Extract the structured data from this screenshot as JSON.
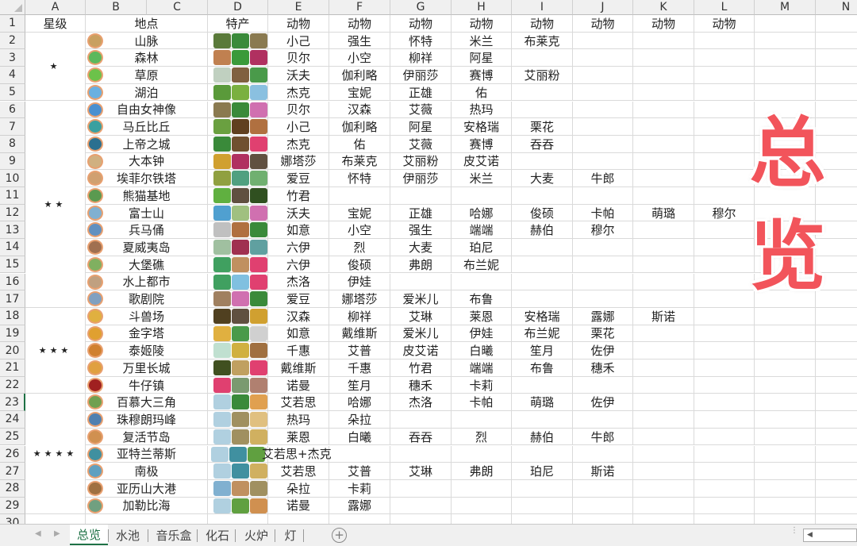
{
  "columns": [
    "A",
    "B",
    "C",
    "D",
    "E",
    "F",
    "G",
    "H",
    "I",
    "J",
    "K",
    "L",
    "M",
    "N"
  ],
  "header_row": {
    "star": "星级",
    "place": "地点",
    "specialty": "特产",
    "animals": [
      "动物",
      "动物",
      "动物",
      "动物",
      "动物",
      "动物",
      "动物",
      "动物"
    ]
  },
  "star_groups": [
    {
      "label": "★",
      "from": 2,
      "to": 5
    },
    {
      "label": "★★",
      "from": 6,
      "to": 17
    },
    {
      "label": "★★★",
      "from": 18,
      "to": 22
    },
    {
      "label": "★★★★",
      "from": 23,
      "to": 29
    }
  ],
  "rows": [
    {
      "place": "山脉",
      "animals": [
        "小己",
        "强生",
        "怀特",
        "米兰",
        "布莱克"
      ]
    },
    {
      "place": "森林",
      "animals": [
        "贝尔",
        "小空",
        "柳祥",
        "阿星"
      ]
    },
    {
      "place": "草原",
      "animals": [
        "沃夫",
        "伽利略",
        "伊丽莎",
        "赛博",
        "艾丽粉"
      ]
    },
    {
      "place": "湖泊",
      "animals": [
        "杰克",
        "宝妮",
        "正雄",
        "佑"
      ]
    },
    {
      "place": "自由女神像",
      "animals": [
        "贝尔",
        "汉森",
        "艾薇",
        "热玛"
      ]
    },
    {
      "place": "马丘比丘",
      "animals": [
        "小己",
        "伽利略",
        "阿星",
        "安格瑞",
        "栗花"
      ]
    },
    {
      "place": "上帝之城",
      "animals": [
        "杰克",
        "佑",
        "艾薇",
        "赛博",
        "吞吞"
      ]
    },
    {
      "place": "大本钟",
      "animals": [
        "娜塔莎",
        "布莱克",
        "艾丽粉",
        "皮艾诺"
      ]
    },
    {
      "place": "埃菲尔铁塔",
      "animals": [
        "爱豆",
        "怀特",
        "伊丽莎",
        "米兰",
        "大麦",
        "牛郎"
      ]
    },
    {
      "place": "熊猫基地",
      "animals": [
        "竹君"
      ]
    },
    {
      "place": "富士山",
      "animals": [
        "沃夫",
        "宝妮",
        "正雄",
        "哈娜",
        "俊硕",
        "卡帕",
        "萌璐",
        "穆尔"
      ]
    },
    {
      "place": "兵马俑",
      "animals": [
        "如意",
        "小空",
        "强生",
        "端端",
        "赫伯",
        "穆尔"
      ]
    },
    {
      "place": "夏威夷岛",
      "animals": [
        "六伊",
        "烈",
        "大麦",
        "珀尼"
      ]
    },
    {
      "place": "大堡礁",
      "animals": [
        "六伊",
        "俊硕",
        "弗朗",
        "布兰妮"
      ]
    },
    {
      "place": "水上都市",
      "animals": [
        "杰洛",
        "伊娃"
      ]
    },
    {
      "place": "歌剧院",
      "animals": [
        "爱豆",
        "娜塔莎",
        "爱米儿",
        "布鲁"
      ]
    },
    {
      "place": "斗兽场",
      "animals": [
        "汉森",
        "柳祥",
        "艾琳",
        "莱恩",
        "安格瑞",
        "露娜",
        "斯诺"
      ]
    },
    {
      "place": "金字塔",
      "animals": [
        "如意",
        "戴维斯",
        "爱米儿",
        "伊娃",
        "布兰妮",
        "栗花"
      ]
    },
    {
      "place": "泰姬陵",
      "animals": [
        "千惠",
        "艾普",
        "皮艾诺",
        "白曦",
        "笙月",
        "佐伊"
      ]
    },
    {
      "place": "万里长城",
      "animals": [
        "戴维斯",
        "千惠",
        "竹君",
        "端端",
        "布鲁",
        "穗禾"
      ]
    },
    {
      "place": "牛仔镇",
      "animals": [
        "诺曼",
        "笙月",
        "穗禾",
        "卡莉"
      ]
    },
    {
      "place": "百慕大三角",
      "animals": [
        "艾若思",
        "哈娜",
        "杰洛",
        "卡帕",
        "萌璐",
        "佐伊"
      ]
    },
    {
      "place": "珠穆朗玛峰",
      "animals": [
        "热玛",
        "朵拉"
      ]
    },
    {
      "place": "复活节岛",
      "animals": [
        "莱恩",
        "白曦",
        "吞吞",
        "烈",
        "赫伯",
        "牛郎"
      ]
    },
    {
      "place": "亚特兰蒂斯",
      "specialty_note": "艾若思+杰克",
      "animals": []
    },
    {
      "place": "南极",
      "animals": [
        "艾若思",
        "艾普",
        "艾琳",
        "弗朗",
        "珀尼",
        "斯诺"
      ]
    },
    {
      "place": "亚历山大港",
      "animals": [
        "朵拉",
        "卡莉"
      ]
    },
    {
      "place": "加勒比海",
      "animals": [
        "诺曼",
        "露娜"
      ]
    }
  ],
  "badge_colors": [
    "#c9a060",
    "#5cb85c",
    "#6cc24a",
    "#6ab0e0",
    "#4a90d0",
    "#3aa0a0",
    "#2a7090",
    "#d0b080",
    "#d0a070",
    "#5a9a50",
    "#80b0d0",
    "#6090c0",
    "#a07050",
    "#80b060",
    "#c0a080",
    "#80a0c0",
    "#e0b040",
    "#e0a030",
    "#d08030",
    "#e0a040",
    "#a02020",
    "#70a050",
    "#5080b0",
    "#d09050",
    "#4090a0",
    "#60a0c0",
    "#a07040",
    "#70a080"
  ],
  "specialty_colors": [
    [
      "#5a7a3a",
      "#3a8a3a",
      "#8a7a50"
    ],
    [
      "#c08050",
      "#3a9a3a",
      "#b03060"
    ],
    [
      "#c0d0c0",
      "#806040",
      "#4a9a4a"
    ],
    [
      "#5a9a3a",
      "#7ab040",
      "#8ac0e0"
    ],
    [
      "#8a7a50",
      "#3a8a3a",
      "#d070b0"
    ],
    [
      "#6aa040",
      "#604020",
      "#b07040"
    ],
    [
      "#3a8a3a",
      "#705030",
      "#e04070"
    ],
    [
      "#d0a030",
      "#b03060",
      "#605040"
    ],
    [
      "#90a040",
      "#50a080",
      "#70b070"
    ],
    [
      "#60b040",
      "#605040",
      "#305020"
    ],
    [
      "#50a0d0",
      "#a0c080",
      "#d070b0"
    ],
    [
      "#c0c0c0",
      "#b07040",
      "#3a8a3a"
    ],
    [
      "#a0c0a0",
      "#a03050",
      "#60a0a0"
    ],
    [
      "#40a060",
      "#c09060",
      "#e04070"
    ],
    [
      "#40a060",
      "#80c0e0",
      "#e04070"
    ],
    [
      "#a08060",
      "#d070b0",
      "#3a8a3a"
    ],
    [
      "#504020",
      "#605040",
      "#d0a030"
    ],
    [
      "#e0b040",
      "#4a9a4a",
      "#d0d0d0"
    ],
    [
      "#c0e0d0",
      "#d0b040",
      "#a07040"
    ],
    [
      "#405020",
      "#c0a060",
      "#e04070"
    ],
    [
      "#e04070",
      "#7a9a70",
      "#b08070"
    ],
    [
      "#b0d0e0",
      "#3a8a3a",
      "#e0a050"
    ],
    [
      "#b0d0e0",
      "#a09060",
      "#e0c080"
    ],
    [
      "#b0d0e0",
      "#a09060",
      "#d0b060"
    ],
    [
      "#b0d0e0",
      "#4090a0",
      "#60a040"
    ],
    [
      "#b0d0e0",
      "#4090a0",
      "#d0b060"
    ],
    [
      "#80b0d0",
      "#c09060",
      "#a09060"
    ],
    [
      "#b0d0e0",
      "#60a040",
      "#d09050"
    ]
  ],
  "overlay_title": [
    "总",
    "览"
  ],
  "sheet_tabs": [
    {
      "label": "总览",
      "active": true
    },
    {
      "label": "水池"
    },
    {
      "label": "音乐盒"
    },
    {
      "label": "化石"
    },
    {
      "label": "火炉"
    },
    {
      "label": "灯"
    }
  ],
  "add_sheet_label": "+"
}
